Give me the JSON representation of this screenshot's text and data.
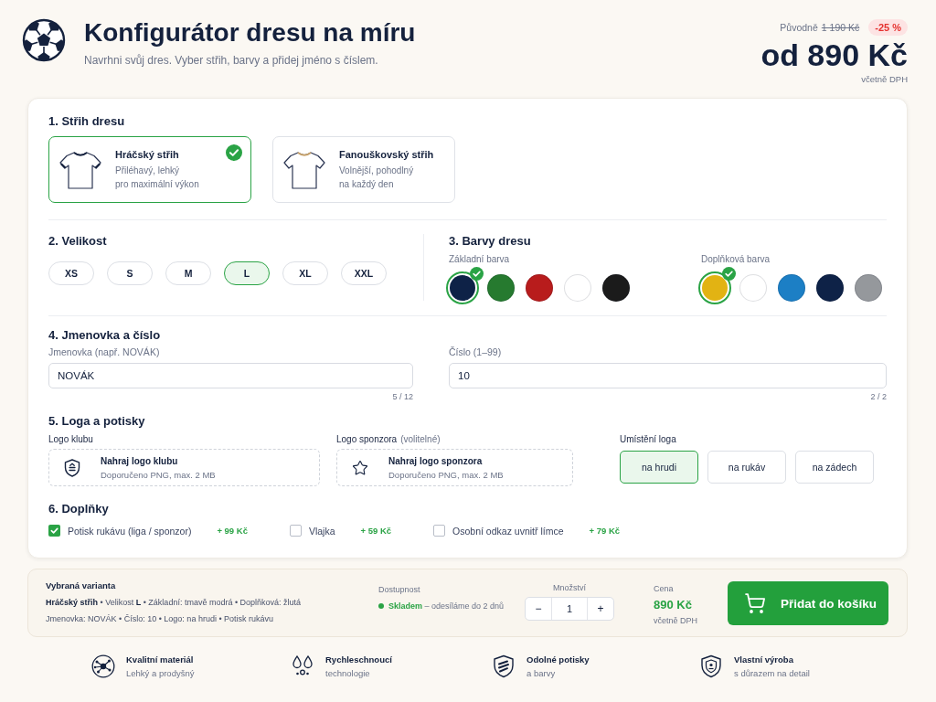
{
  "header": {
    "title": "Konfigurátor dresu na míru",
    "subtitle": "Navrhni svůj dres. Vyber střih, barvy a přidej jméno s číslem.",
    "original_label": "Původně",
    "original_price": "1 190 Kč",
    "discount": "-25 %",
    "price": "od 890 Kč",
    "price_note": "včetně DPH"
  },
  "cut": {
    "title": "1. Střih dresu",
    "options": [
      {
        "name": "Hráčský střih",
        "lines": [
          "Přiléhavý, lehký",
          "pro maximální výkon"
        ],
        "selected": true
      },
      {
        "name": "Fanouškovský střih",
        "lines": [
          "Volnější, pohodlný",
          "na každý den"
        ],
        "selected": false
      }
    ]
  },
  "size": {
    "title": "2. Velikost",
    "options": [
      {
        "label": "XS",
        "selected": false
      },
      {
        "label": "S",
        "selected": false
      },
      {
        "label": "M",
        "selected": false
      },
      {
        "label": "L",
        "selected": true
      },
      {
        "label": "XL",
        "selected": false
      },
      {
        "label": "XXL",
        "selected": false
      }
    ]
  },
  "colors": {
    "title": "3. Barvy dresu",
    "groups": [
      {
        "label": "Základní barva",
        "swatches": [
          {
            "color": "#0e2247",
            "selected": true
          },
          {
            "color": "#267a2f",
            "selected": false
          },
          {
            "color": "#b81c1c",
            "selected": false
          },
          {
            "color": "#ffffff",
            "selected": false
          },
          {
            "color": "#1b1b1b",
            "selected": false
          }
        ]
      },
      {
        "label": "Doplňková barva",
        "swatches": [
          {
            "color": "#e2b313",
            "selected": true
          },
          {
            "color": "#ffffff",
            "selected": false
          },
          {
            "color": "#1c7fc5",
            "selected": false
          },
          {
            "color": "#0e2247",
            "selected": false
          },
          {
            "color": "#95989c",
            "selected": false
          }
        ]
      }
    ]
  },
  "nameplate": {
    "title": "4. Jmenovka a číslo",
    "fields": [
      {
        "label": "Jmenovka (např. NOVÁK)",
        "value": "NOVÁK",
        "counter": "5 / 12"
      },
      {
        "label": "Číslo (1–99)",
        "value": "10",
        "counter": "2 / 2"
      }
    ]
  },
  "logos": {
    "title": "5. Loga a potisky",
    "uploads": [
      {
        "label": "Logo klubu",
        "title": "Nahraj logo klubu",
        "hint": "Doporučeno PNG, max. 2 MB"
      },
      {
        "label": "Logo sponzora",
        "note": "(volitelné)",
        "title": "Nahraj logo sponzora",
        "hint": "Doporučeno PNG, max. 2 MB"
      }
    ],
    "placement": {
      "label": "Umístění loga",
      "options": [
        {
          "label": "na hrudi",
          "selected": true
        },
        {
          "label": "na rukáv",
          "selected": false
        },
        {
          "label": "na zádech",
          "selected": false
        }
      ]
    }
  },
  "addons": {
    "title": "6. Doplňky",
    "items": [
      {
        "label": "Potisk rukávu (liga / sponzor)",
        "price": "+ 99 Kč",
        "checked": true
      },
      {
        "label": "Vlajka",
        "price": "+ 59 Kč",
        "checked": false
      },
      {
        "label": "Osobní odkaz uvnitř límce",
        "price": "+ 79 Kč",
        "checked": false
      }
    ]
  },
  "summary": {
    "title": "Vybraná varianta",
    "lines": [
      "**Hráčský střih** • Velikost **L** • Základní: tmavě modrá • Doplňková: žlutá",
      "Jmenovka: NOVÁK • Číslo: 10 • Logo: na hrudi • Potisk rukávu"
    ]
  },
  "availability": {
    "label": "Dostupnost",
    "status": "**Skladem** – odesíláme do 2 dnů"
  },
  "quantity": {
    "label": "Množství",
    "decrement": "−",
    "value": "1",
    "increment": "+"
  },
  "total": {
    "label": "Cena",
    "price": "890 Kč",
    "note": "včetně DPH"
  },
  "cart_button": "Přidat do košíku",
  "features": [
    {
      "title": "Kvalitní materiál",
      "subtitle": "Lehký a prodyšný"
    },
    {
      "title": "Rychleschnoucí",
      "subtitle": "technologie"
    },
    {
      "title": "Odolné potisky",
      "subtitle": "a barvy"
    },
    {
      "title": "Vlastní výroba",
      "subtitle": "s důrazem na detail"
    }
  ]
}
